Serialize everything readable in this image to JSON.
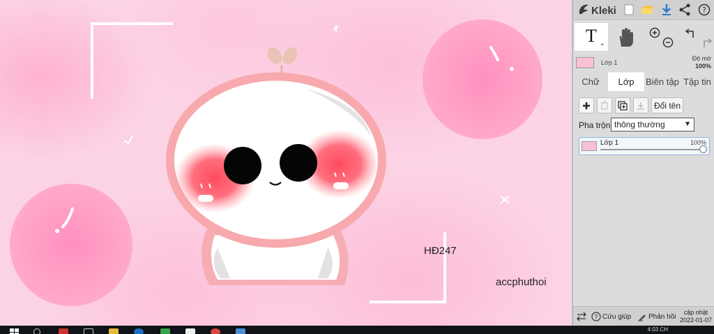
{
  "app": {
    "name": "Kleki"
  },
  "canvas": {
    "texts": {
      "hd247": "HĐ247",
      "signature": "accphuthoi"
    }
  },
  "tools": {
    "text_tool_glyph": "T",
    "text_tool_sub": "⌄"
  },
  "layer_info": {
    "name": "Lớp 1",
    "opacity_label": "Độ mờ",
    "opacity_value": "100%"
  },
  "tabs": [
    {
      "label": "Chữ",
      "active": false
    },
    {
      "label": "Lớp",
      "active": true
    },
    {
      "label": "Biên tập",
      "active": false
    },
    {
      "label": "Tập tin",
      "active": false
    }
  ],
  "layers_panel": {
    "rename_label": "Đổi tên",
    "blend_label": "Pha trộn",
    "blend_value": "thông thường",
    "layers": [
      {
        "name": "Lớp 1",
        "opacity": "100%"
      }
    ]
  },
  "bottom_bar": {
    "help_label": "Cứu giúp",
    "feedback_label": "Phản hồi",
    "update_label": "cập nhật",
    "update_date": "2022-01-07"
  },
  "taskbar": {
    "clock": "4:03 CH"
  },
  "icons": {
    "logo": "kleki-logo-icon",
    "new": "new-file-icon",
    "open": "open-folder-icon",
    "download": "download-icon",
    "share": "share-icon",
    "help": "help-icon",
    "hand": "hand-icon",
    "zoom_in": "zoom-in-icon",
    "zoom_out": "zoom-out-icon",
    "undo": "undo-icon",
    "redo": "redo-icon",
    "add_layer": "plus-icon",
    "delete_layer": "trash-icon",
    "duplicate_layer": "duplicate-icon",
    "merge_layer": "merge-down-icon",
    "swap": "swap-icon",
    "feedback": "feedback-icon"
  },
  "colors": {
    "accent_blue": "#2a7bd1",
    "sidebar_bg": "#dcdcdc",
    "canvas_pink": "#fcd3e5",
    "blush_red": "#ff5a6a"
  }
}
